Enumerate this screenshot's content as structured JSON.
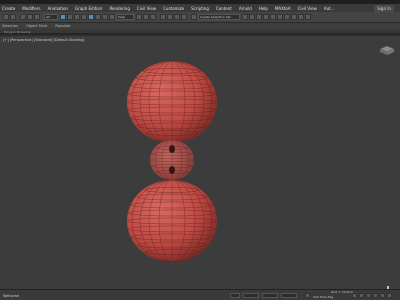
{
  "menu": {
    "items": [
      "Create",
      "Modifiers",
      "Animation",
      "Graph Editors",
      "Rendering",
      "Civil View",
      "Customize",
      "Scripting",
      "Content",
      "Arnold",
      "Help",
      "MAXtoA",
      "Civil View",
      "Aut..."
    ],
    "signin": "Sign In"
  },
  "toolbar": {
    "view_dropdown": "View",
    "selection_set": "Create Selection Set"
  },
  "ribbon": {
    "tabs": [
      "Selection",
      "Object Paint",
      "Populate"
    ],
    "panel_text": "Polygon Modeling"
  },
  "viewport": {
    "label": "[+] [Perspective] [Standard] [Default Shading]",
    "mesh_color": "#c8504a",
    "background": "#3c3c3c"
  },
  "statusbar": {
    "status": "Welcome",
    "grid": "Grid = 10.0cm",
    "add_time_tag": "Add Time Tag"
  }
}
